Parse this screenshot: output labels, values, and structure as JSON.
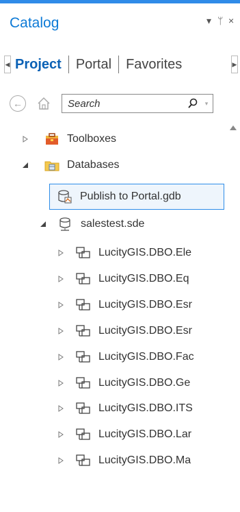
{
  "pane": {
    "title": "Catalog",
    "pin_glyph": "▾ ⊥ ×"
  },
  "tabs": [
    {
      "label": "Project",
      "active": true
    },
    {
      "label": "Portal",
      "active": false
    },
    {
      "label": "Favorites",
      "active": false
    }
  ],
  "search": {
    "placeholder": "Search"
  },
  "tree": [
    {
      "label": "Toolboxes",
      "icon": "toolbox-icon",
      "expander": "collapsed"
    },
    {
      "label": "Databases",
      "icon": "databases-folder-icon",
      "expander": "expanded"
    },
    {
      "label": "Publish to Portal.gdb",
      "icon": "geodatabase-icon",
      "expander": "none",
      "selected": true
    },
    {
      "label": "salestest.sde",
      "icon": "database-connection-icon",
      "expander": "expanded"
    },
    {
      "label": "LucityGIS.DBO.Ele",
      "icon": "feature-dataset-icon",
      "expander": "collapsed"
    },
    {
      "label": "LucityGIS.DBO.Eq",
      "icon": "feature-dataset-icon",
      "expander": "collapsed"
    },
    {
      "label": "LucityGIS.DBO.Esr",
      "icon": "feature-dataset-icon",
      "expander": "collapsed"
    },
    {
      "label": "LucityGIS.DBO.Esr",
      "icon": "feature-dataset-icon",
      "expander": "collapsed"
    },
    {
      "label": "LucityGIS.DBO.Fac",
      "icon": "feature-dataset-icon",
      "expander": "collapsed"
    },
    {
      "label": "LucityGIS.DBO.Ge",
      "icon": "feature-dataset-icon",
      "expander": "collapsed"
    },
    {
      "label": "LucityGIS.DBO.ITS",
      "icon": "feature-dataset-icon",
      "expander": "collapsed"
    },
    {
      "label": "LucityGIS.DBO.Lar",
      "icon": "feature-dataset-icon",
      "expander": "collapsed"
    },
    {
      "label": "LucityGIS.DBO.Ma",
      "icon": "feature-dataset-icon",
      "expander": "collapsed"
    }
  ],
  "colors": {
    "accent": "#2f8be8",
    "title": "#0d7ad6",
    "active_tab": "#0b61b5",
    "selection_border": "#2d8ce8"
  }
}
